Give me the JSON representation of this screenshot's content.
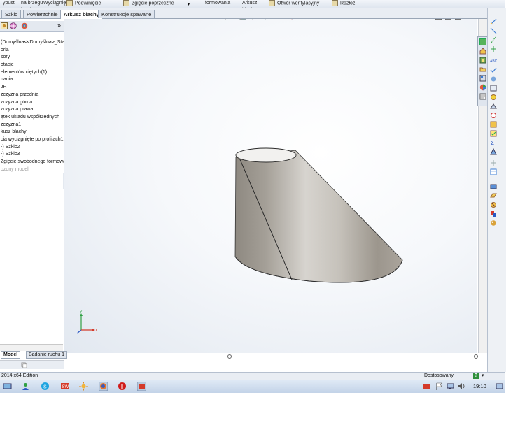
{
  "ribbon": {
    "items": [
      {
        "label": "ypust",
        "icon": "extrude-icon"
      },
      {
        "label": "na brzegu\nblachy",
        "icon": "edge-flange-icon"
      },
      {
        "label": "Wyciągnię\nęte po ...",
        "icon": "lofted-bend-icon"
      },
      {
        "label": "Podwinięcie",
        "icon": "hem-icon"
      },
      {
        "label": "Zgięcie poprzeczne",
        "icon": "cross-break-icon"
      },
      {
        "label": "formowania",
        "icon": "forming-tool-icon"
      },
      {
        "label": "Arkusz\nblachy",
        "icon": "sheet-metal-icon"
      },
      {
        "label": "Otwór wentylacyjny",
        "icon": "vent-icon"
      },
      {
        "label": "Rozłóż",
        "icon": "unfold-icon"
      }
    ]
  },
  "tabs": [
    {
      "label": "Szkic",
      "active": false
    },
    {
      "label": "Powierzchnie",
      "active": false
    },
    {
      "label": "Arkusz blachy",
      "active": true
    },
    {
      "label": "Konstrukcje spawane",
      "active": false
    }
  ],
  "feature_tree": {
    "items": [
      {
        "label": "(Domyślna<<Domyślna>_Sta",
        "muted": false
      },
      {
        "label": "oria",
        "muted": false
      },
      {
        "label": "sory",
        "muted": false
      },
      {
        "label": "otacje",
        "muted": false
      },
      {
        "label": "elementów ciętych(1)",
        "muted": false
      },
      {
        "label": "nania",
        "muted": false
      },
      {
        "label": "JR",
        "muted": false
      },
      {
        "label": "zczyzna przednia",
        "muted": false
      },
      {
        "label": "zczyzna górna",
        "muted": false
      },
      {
        "label": "zczyzna prawa",
        "muted": false
      },
      {
        "label": "ątek układu współrzędnych",
        "muted": false
      },
      {
        "label": "zczyzna1",
        "muted": false
      },
      {
        "label": "kusz blachy",
        "muted": false
      },
      {
        "label": "cia wyciągnięte po profilach1",
        "muted": false
      },
      {
        "label": "-) Szkic2",
        "muted": false
      },
      {
        "label": "-) Szkic3",
        "muted": false
      },
      {
        "label": "Zgięcie swobodnego formowa",
        "muted": false
      },
      {
        "label": "ozony model",
        "muted": true
      }
    ]
  },
  "bottom_tabs": [
    {
      "label": "Model",
      "active": true
    },
    {
      "label": "Badanie ruchu 1",
      "active": false
    }
  ],
  "status_bar": {
    "edition": "2014 x64 Edition",
    "units": "Dostosowany",
    "help": "?"
  },
  "taskbar": {
    "time": "19:10"
  },
  "colors": {
    "accent": "#3b6fc4",
    "model_fill": "#b6b1aa",
    "model_shade": "#8e8981",
    "axis_x": "#d43a2a",
    "axis_y": "#2fa043",
    "axis_z": "#2b59c3"
  }
}
